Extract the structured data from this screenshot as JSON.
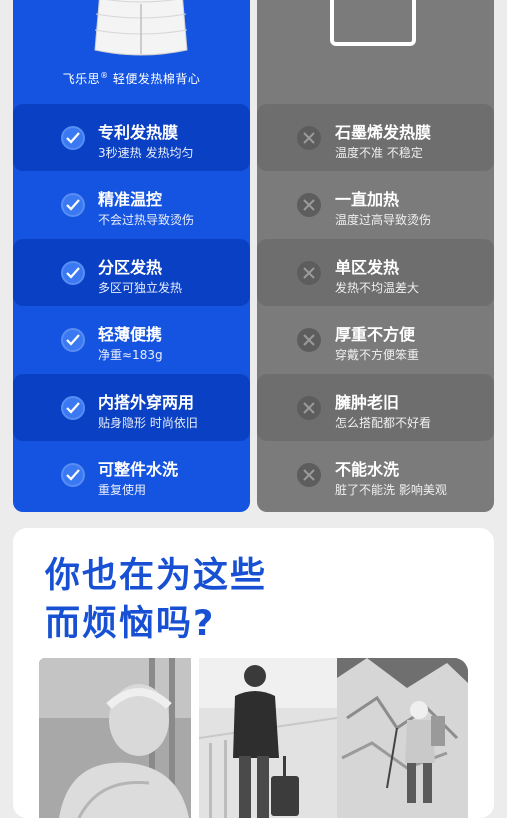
{
  "left_panel": {
    "brand_name": "飞乐思",
    "brand_mark": "®",
    "product_name": "轻便发热棉背心",
    "items": [
      {
        "title": "专利发热膜",
        "subtitle": "3秒速热 发热均匀"
      },
      {
        "title": "精准温控",
        "subtitle": "不会过热导致烫伤"
      },
      {
        "title": "分区发热",
        "subtitle": "多区可独立发热"
      },
      {
        "title": "轻薄便携",
        "subtitle": "净重≈183g"
      },
      {
        "title": "内搭外穿两用",
        "subtitle": "贴身隐形 时尚依旧"
      },
      {
        "title": "可整件水洗",
        "subtitle": "重复使用"
      }
    ]
  },
  "right_panel": {
    "items": [
      {
        "title": "石墨烯发热膜",
        "subtitle": "温度不准 不稳定"
      },
      {
        "title": "一直加热",
        "subtitle": "温度过高导致烫伤"
      },
      {
        "title": "单区发热",
        "subtitle": "发热不均温差大"
      },
      {
        "title": "厚重不方便",
        "subtitle": "穿戴不方便笨重"
      },
      {
        "title": "臃肿老旧",
        "subtitle": "怎么搭配都不好看"
      },
      {
        "title": "不能水洗",
        "subtitle": "脏了不能洗 影响美观"
      }
    ]
  },
  "question_section": {
    "headline_line1": "你也在为这些",
    "headline_line2": "而烦恼吗?"
  },
  "colors": {
    "accent_blue": "#1554e0",
    "highlight_blue": "#0a40c4",
    "panel_gray": "#7b7b7b",
    "headline_blue": "#1850d4"
  }
}
